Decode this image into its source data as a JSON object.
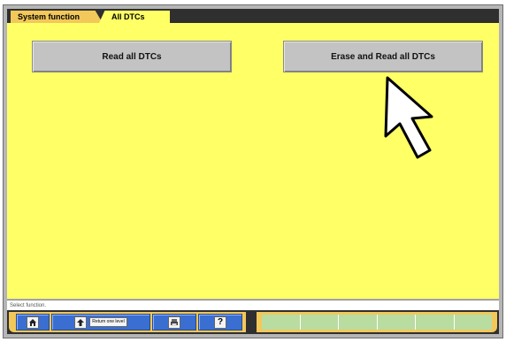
{
  "breadcrumb": {
    "tabs": [
      {
        "label": "System function"
      },
      {
        "label": "All DTCs"
      }
    ]
  },
  "main": {
    "read_button_label": "Read all DTCs",
    "erase_button_label": "Erase and Read all DTCs"
  },
  "status_bar": {
    "text": "Select function."
  },
  "toolbar": {
    "return_label": "Return one level",
    "help_glyph": "?",
    "icons": [
      "home-icon",
      "return-arrow-icon",
      "print-icon",
      "help-icon"
    ]
  },
  "colors": {
    "content_bg": "#ffff66",
    "tab_bg": "#f2c85a",
    "button_bg": "#c3c3c3",
    "toolbar_button": "#3a6fd1",
    "status_green": "#b9dca1"
  }
}
